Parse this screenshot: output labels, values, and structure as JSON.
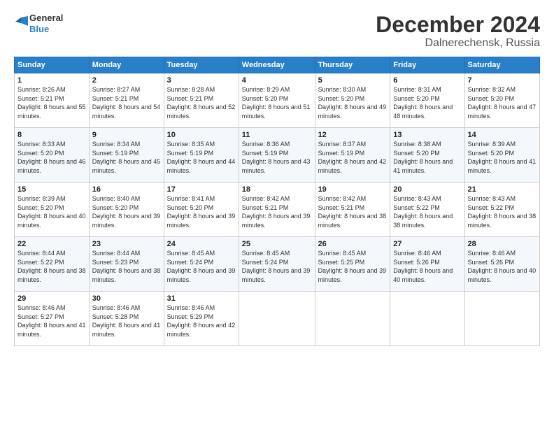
{
  "logo": {
    "line1": "General",
    "line2": "Blue"
  },
  "title": "December 2024",
  "subtitle": "Dalnerechensk, Russia",
  "header_days": [
    "Sunday",
    "Monday",
    "Tuesday",
    "Wednesday",
    "Thursday",
    "Friday",
    "Saturday"
  ],
  "weeks": [
    [
      {
        "day": "1",
        "sunrise": "8:26 AM",
        "sunset": "5:21 PM",
        "daylight": "8 hours and 55 minutes."
      },
      {
        "day": "2",
        "sunrise": "8:27 AM",
        "sunset": "5:21 PM",
        "daylight": "8 hours and 54 minutes."
      },
      {
        "day": "3",
        "sunrise": "8:28 AM",
        "sunset": "5:21 PM",
        "daylight": "8 hours and 52 minutes."
      },
      {
        "day": "4",
        "sunrise": "8:29 AM",
        "sunset": "5:20 PM",
        "daylight": "8 hours and 51 minutes."
      },
      {
        "day": "5",
        "sunrise": "8:30 AM",
        "sunset": "5:20 PM",
        "daylight": "8 hours and 49 minutes."
      },
      {
        "day": "6",
        "sunrise": "8:31 AM",
        "sunset": "5:20 PM",
        "daylight": "8 hours and 48 minutes."
      },
      {
        "day": "7",
        "sunrise": "8:32 AM",
        "sunset": "5:20 PM",
        "daylight": "8 hours and 47 minutes."
      }
    ],
    [
      {
        "day": "8",
        "sunrise": "8:33 AM",
        "sunset": "5:20 PM",
        "daylight": "8 hours and 46 minutes."
      },
      {
        "day": "9",
        "sunrise": "8:34 AM",
        "sunset": "5:19 PM",
        "daylight": "8 hours and 45 minutes."
      },
      {
        "day": "10",
        "sunrise": "8:35 AM",
        "sunset": "5:19 PM",
        "daylight": "8 hours and 44 minutes."
      },
      {
        "day": "11",
        "sunrise": "8:36 AM",
        "sunset": "5:19 PM",
        "daylight": "8 hours and 43 minutes."
      },
      {
        "day": "12",
        "sunrise": "8:37 AM",
        "sunset": "5:19 PM",
        "daylight": "8 hours and 42 minutes."
      },
      {
        "day": "13",
        "sunrise": "8:38 AM",
        "sunset": "5:20 PM",
        "daylight": "8 hours and 41 minutes."
      },
      {
        "day": "14",
        "sunrise": "8:39 AM",
        "sunset": "5:20 PM",
        "daylight": "8 hours and 41 minutes."
      }
    ],
    [
      {
        "day": "15",
        "sunrise": "8:39 AM",
        "sunset": "5:20 PM",
        "daylight": "8 hours and 40 minutes."
      },
      {
        "day": "16",
        "sunrise": "8:40 AM",
        "sunset": "5:20 PM",
        "daylight": "8 hours and 39 minutes."
      },
      {
        "day": "17",
        "sunrise": "8:41 AM",
        "sunset": "5:20 PM",
        "daylight": "8 hours and 39 minutes."
      },
      {
        "day": "18",
        "sunrise": "8:42 AM",
        "sunset": "5:21 PM",
        "daylight": "8 hours and 39 minutes."
      },
      {
        "day": "19",
        "sunrise": "8:42 AM",
        "sunset": "5:21 PM",
        "daylight": "8 hours and 38 minutes."
      },
      {
        "day": "20",
        "sunrise": "8:43 AM",
        "sunset": "5:22 PM",
        "daylight": "8 hours and 38 minutes."
      },
      {
        "day": "21",
        "sunrise": "8:43 AM",
        "sunset": "5:22 PM",
        "daylight": "8 hours and 38 minutes."
      }
    ],
    [
      {
        "day": "22",
        "sunrise": "8:44 AM",
        "sunset": "5:22 PM",
        "daylight": "8 hours and 38 minutes."
      },
      {
        "day": "23",
        "sunrise": "8:44 AM",
        "sunset": "5:23 PM",
        "daylight": "8 hours and 38 minutes."
      },
      {
        "day": "24",
        "sunrise": "8:45 AM",
        "sunset": "5:24 PM",
        "daylight": "8 hours and 39 minutes."
      },
      {
        "day": "25",
        "sunrise": "8:45 AM",
        "sunset": "5:24 PM",
        "daylight": "8 hours and 39 minutes."
      },
      {
        "day": "26",
        "sunrise": "8:45 AM",
        "sunset": "5:25 PM",
        "daylight": "8 hours and 39 minutes."
      },
      {
        "day": "27",
        "sunrise": "8:46 AM",
        "sunset": "5:26 PM",
        "daylight": "8 hours and 40 minutes."
      },
      {
        "day": "28",
        "sunrise": "8:46 AM",
        "sunset": "5:26 PM",
        "daylight": "8 hours and 40 minutes."
      }
    ],
    [
      {
        "day": "29",
        "sunrise": "8:46 AM",
        "sunset": "5:27 PM",
        "daylight": "8 hours and 41 minutes."
      },
      {
        "day": "30",
        "sunrise": "8:46 AM",
        "sunset": "5:28 PM",
        "daylight": "8 hours and 41 minutes."
      },
      {
        "day": "31",
        "sunrise": "8:46 AM",
        "sunset": "5:29 PM",
        "daylight": "8 hours and 42 minutes."
      },
      null,
      null,
      null,
      null
    ]
  ],
  "labels": {
    "sunrise": "Sunrise:",
    "sunset": "Sunset:",
    "daylight": "Daylight:"
  }
}
